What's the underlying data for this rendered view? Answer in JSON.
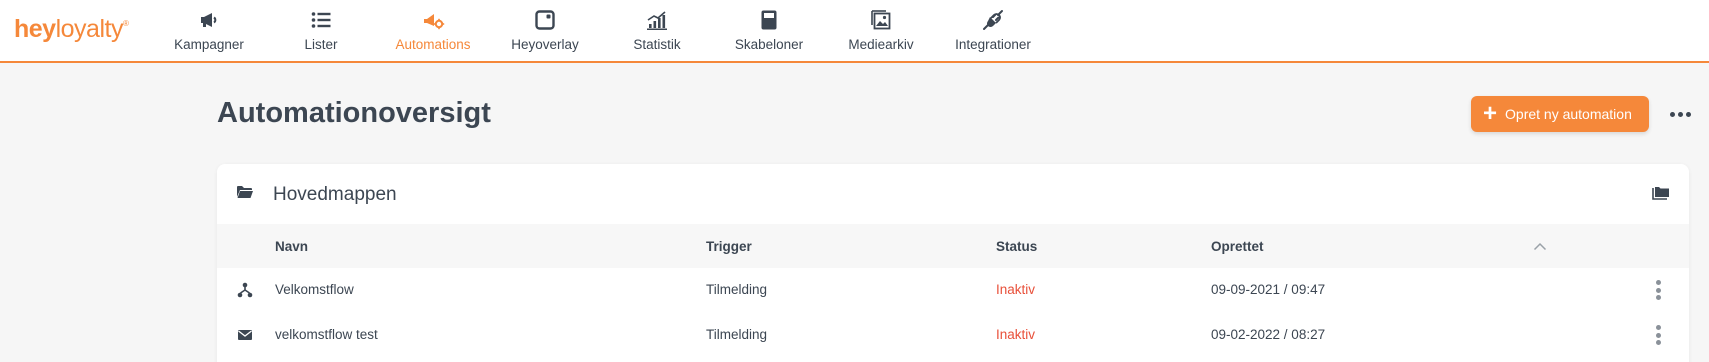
{
  "brand": {
    "logo_bold": "hey",
    "logo_light": "loyalty",
    "logo_mark": "®",
    "accent": "#f5883a",
    "danger": "#e8503a"
  },
  "nav": [
    {
      "label": "Kampagner",
      "icon": "megaphone-icon",
      "active": false
    },
    {
      "label": "Lister",
      "icon": "list-icon",
      "active": false
    },
    {
      "label": "Automations",
      "icon": "automation-icon",
      "active": true
    },
    {
      "label": "Heyoverlay",
      "icon": "overlay-icon",
      "active": false
    },
    {
      "label": "Statistik",
      "icon": "chart-icon",
      "active": false
    },
    {
      "label": "Skabeloner",
      "icon": "template-icon",
      "active": false
    },
    {
      "label": "Mediearkiv",
      "icon": "media-icon",
      "active": false
    },
    {
      "label": "Integrationer",
      "icon": "plug-icon",
      "active": false
    }
  ],
  "header": {
    "title": "Automationoversigt",
    "create_label": "Opret ny automation",
    "create_icon": "plus-icon",
    "more_icon": "more-horizontal-icon"
  },
  "folder": {
    "name": "Hovedmappen",
    "icon": "folder-open-icon",
    "folders_icon": "folders-icon",
    "columns": {
      "name": "Navn",
      "trigger": "Trigger",
      "status": "Status",
      "created": "Oprettet"
    },
    "sort_icon": "chevron-up-icon",
    "rows": [
      {
        "icon": "flow-icon",
        "name": "Velkomstflow",
        "trigger": "Tilmelding",
        "status": "Inaktiv",
        "created": "09-09-2021 / 09:47"
      },
      {
        "icon": "envelope-icon",
        "name": "velkomstflow test",
        "trigger": "Tilmelding",
        "status": "Inaktiv",
        "created": "09-02-2022 / 08:27"
      }
    ]
  }
}
